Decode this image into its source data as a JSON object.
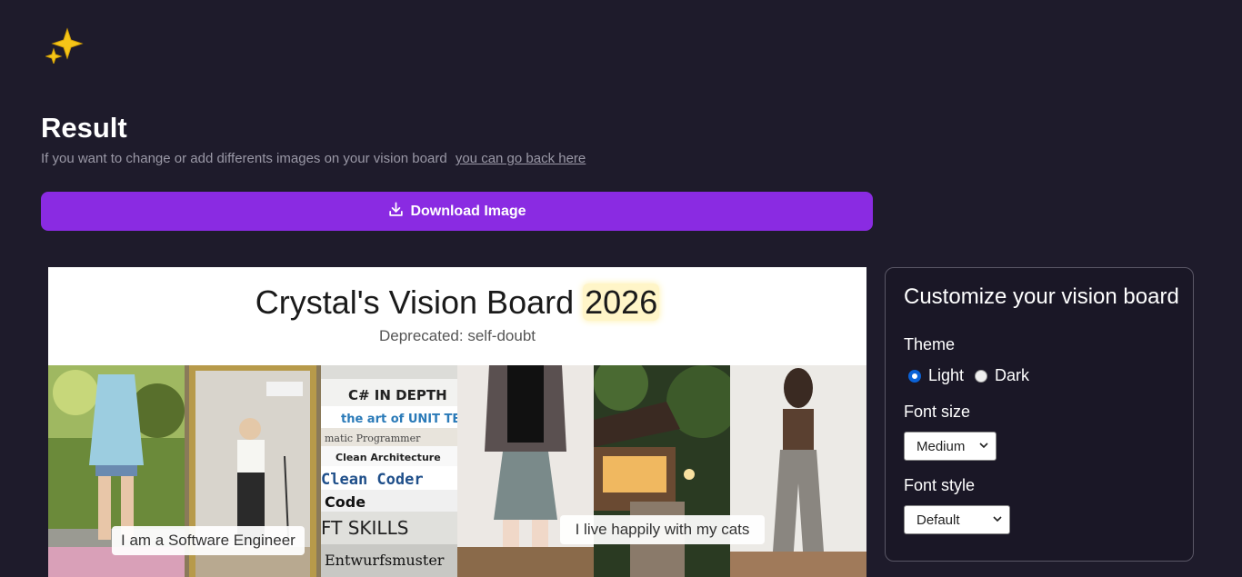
{
  "header": {
    "logo_icon": "sparkles-icon",
    "title": "Result",
    "subtitle_text": "If you want to change or add differents images on your vision board",
    "back_link": "you can go back here",
    "download_label": "Download Image",
    "download_icon": "download-icon"
  },
  "board": {
    "title_prefix": "Crystal's Vision Board",
    "year": "2026",
    "subtitle": "Deprecated: self-doubt",
    "captions": [
      "I am a Software Engineer",
      "I live happily with my cats"
    ]
  },
  "panel": {
    "title": "Customize your vision board",
    "theme_label": "Theme",
    "theme_options": [
      "Light",
      "Dark"
    ],
    "theme_selected": "Light",
    "font_size_label": "Font size",
    "font_size_value": "Medium",
    "font_style_label": "Font style",
    "font_style_value": "Default"
  },
  "colors": {
    "background": "#1e1b2b",
    "accent": "#8a2be2",
    "radio_checked": "#0b62d6",
    "year_highlight": "#fff5c8"
  }
}
